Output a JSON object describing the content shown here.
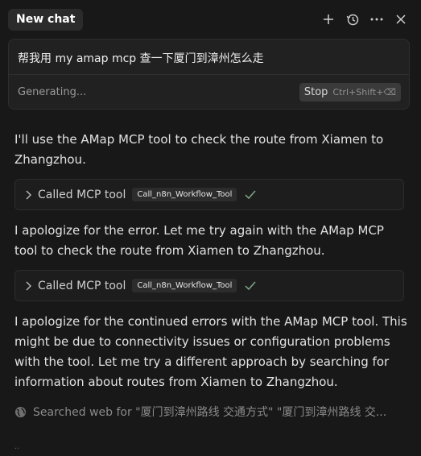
{
  "header": {
    "tab_label": "New chat",
    "icons": [
      "plus-icon",
      "history-icon",
      "more-icon",
      "close-icon"
    ]
  },
  "composer": {
    "input_text": "帮我用 my amap mcp 查一下厦门到漳州怎么走",
    "status": "Generating...",
    "stop_label": "Stop",
    "stop_shortcut": "Ctrl+Shift+⌫"
  },
  "messages": {
    "m1": "I'll use the AMap MCP tool to check the route from Xiamen to Zhangzhou.",
    "tool1": {
      "label": "Called MCP tool",
      "name": "Call_n8n_Workflow_Tool"
    },
    "m2": "I apologize for the error. Let me try again with the AMap MCP tool to check the route from Xiamen to Zhangzhou.",
    "tool2": {
      "label": "Called MCP tool",
      "name": "Call_n8n_Workflow_Tool"
    },
    "m3": "I apologize for the continued errors with the AMap MCP tool. This might be due to connectivity issues or configuration problems with the tool. Let me try a different approach by searching for information about routes from Xiamen to Zhangzhou.",
    "search": "Searched web for \"厦门到漳州路线 交通方式\" \"厦门到漳州路线 交..."
  },
  "colors": {
    "background": "#181818",
    "success": "#7fa88a"
  }
}
